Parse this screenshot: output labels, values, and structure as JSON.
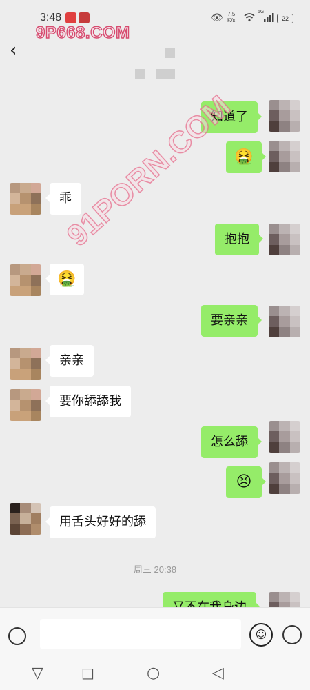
{
  "status_bar": {
    "time": "3:48",
    "speed_value": "7.5",
    "speed_unit": "K/s",
    "battery": "22",
    "network": "5G"
  },
  "watermark": {
    "top": "9P668.COM",
    "diagonal": "91PORN.COM"
  },
  "icons": {
    "back": "chevron-left-icon",
    "eye": "eye-icon",
    "wifi": "wifi-icon",
    "signal": "signal-icon",
    "voice": "voice-icon",
    "emoji": "emoji-icon",
    "plus": "plus-icon"
  },
  "messages": [
    {
      "side": "out",
      "text": "知道了"
    },
    {
      "side": "out",
      "text": "🤮"
    },
    {
      "side": "in",
      "text": "乖"
    },
    {
      "side": "out",
      "text": "抱抱"
    },
    {
      "side": "in",
      "text": "🤮"
    },
    {
      "side": "out",
      "text": "要亲亲"
    },
    {
      "side": "in",
      "text": "亲亲"
    },
    {
      "side": "in",
      "text": "要你舔舔我"
    },
    {
      "side": "out",
      "text": "怎么舔"
    },
    {
      "side": "out",
      "text": "😣"
    },
    {
      "side": "in",
      "text": "用舌头好好的舔"
    },
    {
      "side": "out",
      "text": "又不在我身边"
    }
  ],
  "timestamp": "周三 20:38",
  "nav": {
    "back": "▽",
    "home": "○",
    "recent": "◁"
  },
  "colors": {
    "outgoing_bubble": "#95ec69",
    "incoming_bubble": "#ffffff",
    "background": "#ededed"
  }
}
